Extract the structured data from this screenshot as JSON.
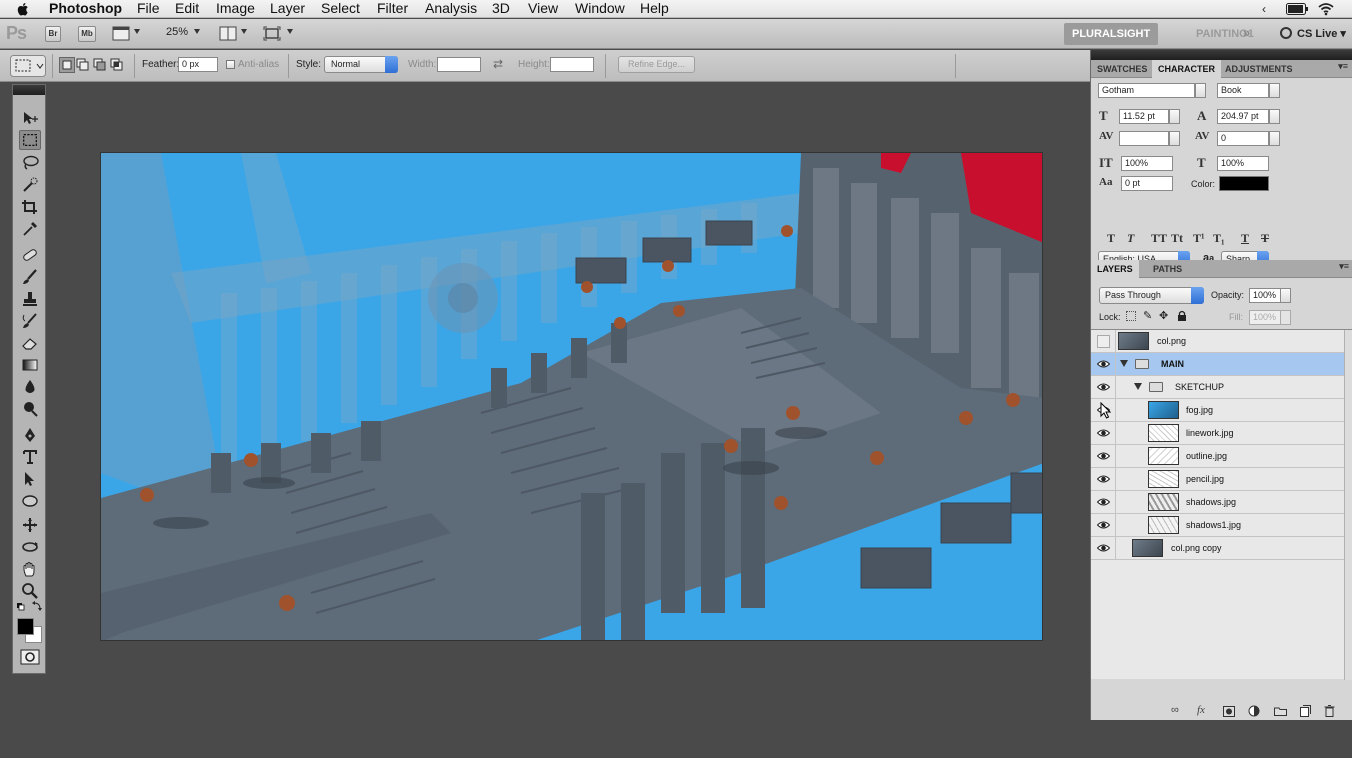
{
  "menubar": {
    "app_name": "Photoshop",
    "items": [
      "File",
      "Edit",
      "Image",
      "Layer",
      "Select",
      "Filter",
      "Analysis",
      "3D",
      "View",
      "Window",
      "Help"
    ]
  },
  "appbar": {
    "ps_logo": "Ps",
    "br_label": "Br",
    "mb_label": "Mb",
    "zoom": "25%",
    "workspace_active": "PLURALSIGHT",
    "workspace_other": "PAINTING1",
    "cslive": "CS Live"
  },
  "options": {
    "feather_label": "Feather:",
    "feather_value": "0 px",
    "antialias_label": "Anti-alias",
    "style_label": "Style:",
    "style_value": "Normal",
    "width_label": "Width:",
    "height_label": "Height:",
    "refine_edge": "Refine Edge..."
  },
  "character_panel": {
    "tabs": [
      "SWATCHES",
      "CHARACTER",
      "ADJUSTMENTS"
    ],
    "active_tab": "CHARACTER",
    "font_family": "Gotham",
    "font_style": "Book",
    "font_size": "11.52 pt",
    "leading": "204.97 pt",
    "kerning": "",
    "tracking": "0",
    "vertical_scale": "100%",
    "horizontal_scale": "100%",
    "baseline_shift": "0 pt",
    "color_label": "Color:",
    "color_value": "#000000",
    "language": "English: USA",
    "aa_glyph": "a",
    "antialiasing": "Sharp"
  },
  "layers_panel": {
    "tabs": [
      "LAYERS",
      "PATHS"
    ],
    "active_tab": "LAYERS",
    "blend_mode": "Pass Through",
    "opacity_label": "Opacity:",
    "opacity": "100%",
    "lock_label": "Lock:",
    "fill_label": "Fill:",
    "fill": "100%",
    "layers": [
      {
        "name": "col.png",
        "visible": false,
        "type": "image"
      },
      {
        "name": "MAIN",
        "visible": true,
        "type": "group",
        "selected": true
      },
      {
        "name": "SKETCHUP",
        "visible": true,
        "type": "group"
      },
      {
        "name": "fog.jpg",
        "visible": true,
        "type": "image"
      },
      {
        "name": "linework.jpg",
        "visible": true,
        "type": "image"
      },
      {
        "name": "outline.jpg",
        "visible": true,
        "type": "image"
      },
      {
        "name": "pencil.jpg",
        "visible": true,
        "type": "image"
      },
      {
        "name": "shadows.jpg",
        "visible": true,
        "type": "image"
      },
      {
        "name": "shadows1.jpg",
        "visible": true,
        "type": "image"
      },
      {
        "name": "col.png copy",
        "visible": true,
        "type": "image"
      }
    ]
  },
  "colors": {
    "sky": "#3aa6e8",
    "stone": "#5e6b78",
    "selection": "#a6c8f0",
    "accent_red": "#c8102e"
  }
}
